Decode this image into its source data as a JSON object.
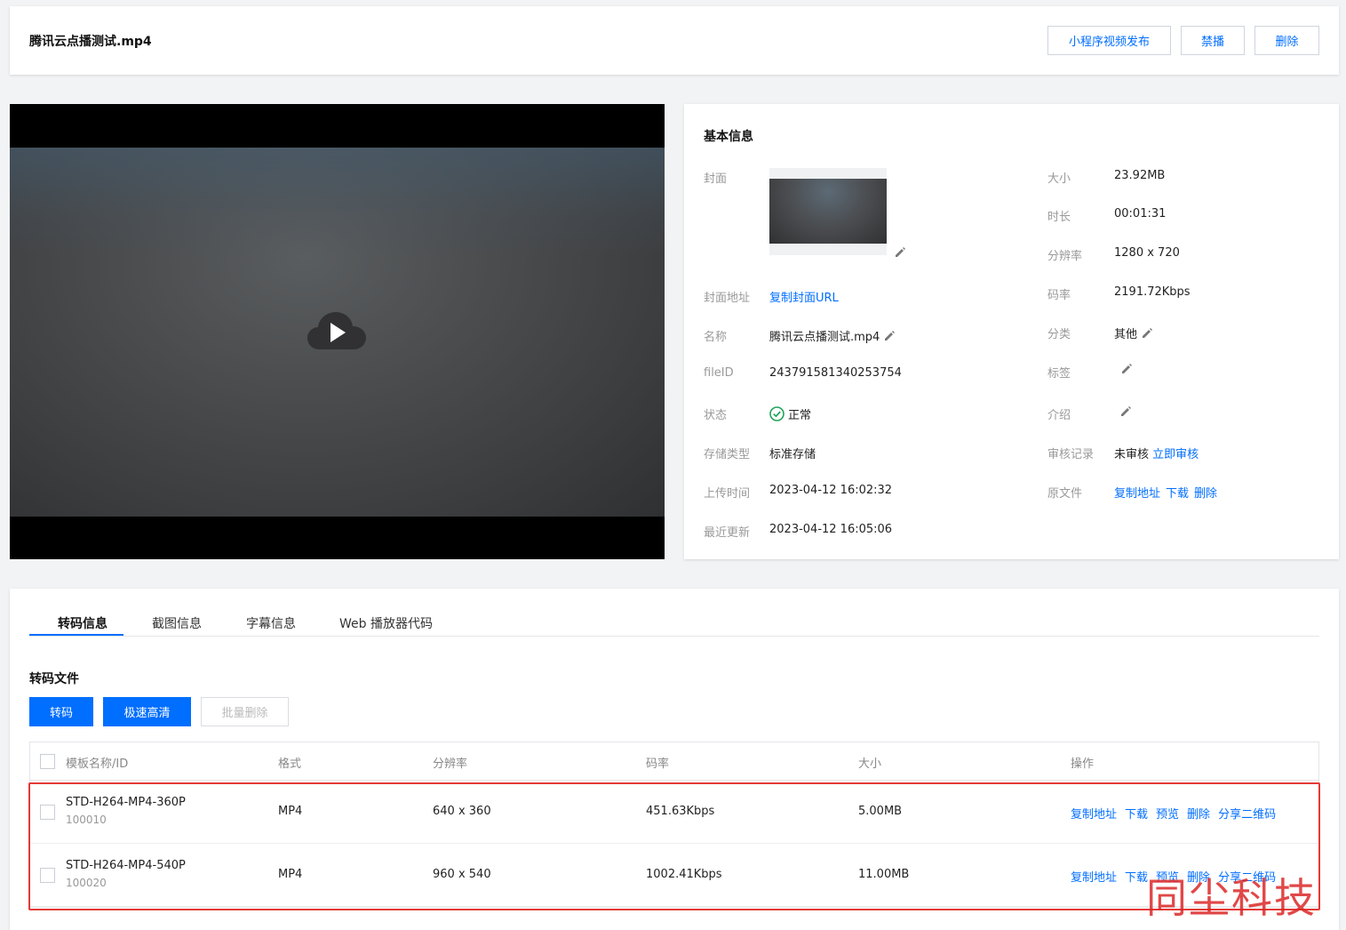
{
  "header": {
    "title": "腾讯云点播测试.mp4",
    "buttons": {
      "publish": "小程序视频发布",
      "ban": "禁播",
      "delete": "删除"
    }
  },
  "info": {
    "title": "基本信息",
    "left": {
      "cover_label": "封面",
      "cover_url_label": "封面地址",
      "cover_url_link": "复制封面URL",
      "name_label": "名称",
      "name_value": "腾讯云点播测试.mp4",
      "fileid_label": "fileID",
      "fileid_value": "243791581340253754",
      "status_label": "状态",
      "status_value": "正常",
      "storage_label": "存储类型",
      "storage_value": "标准存储",
      "upload_label": "上传时间",
      "upload_value": "2023-04-12 16:02:32",
      "update_label": "最近更新",
      "update_value": "2023-04-12 16:05:06"
    },
    "right": {
      "size_label": "大小",
      "size_value": "23.92MB",
      "duration_label": "时长",
      "duration_value": "00:01:31",
      "resolution_label": "分辨率",
      "resolution_value": "1280 x 720",
      "bitrate_label": "码率",
      "bitrate_value": "2191.72Kbps",
      "category_label": "分类",
      "category_value": "其他",
      "tags_label": "标签",
      "intro_label": "介绍",
      "review_label": "审核记录",
      "review_value": "未审核",
      "review_link": "立即审核",
      "source_label": "原文件",
      "source_links": [
        "复制地址",
        "下载",
        "删除"
      ]
    }
  },
  "tabs": [
    "转码信息",
    "截图信息",
    "字幕信息",
    "Web 播放器代码"
  ],
  "transcode": {
    "title": "转码文件",
    "buttons": {
      "transcode": "转码",
      "tesla": "极速高清",
      "batch_delete": "批量删除"
    },
    "columns": [
      "模板名称/ID",
      "格式",
      "分辨率",
      "码率",
      "大小",
      "操作"
    ],
    "rows": [
      {
        "name": "STD-H264-MP4-360P",
        "id": "100010",
        "format": "MP4",
        "resolution": "640 x 360",
        "bitrate": "451.63Kbps",
        "size": "5.00MB"
      },
      {
        "name": "STD-H264-MP4-540P",
        "id": "100020",
        "format": "MP4",
        "resolution": "960 x 540",
        "bitrate": "1002.41Kbps",
        "size": "11.00MB"
      }
    ],
    "ops": [
      "复制地址",
      "下载",
      "预览",
      "删除",
      "分享二维码"
    ]
  },
  "watermark": "同尘科技",
  "colors": {
    "accent": "#006eff",
    "highlight": "#e53935",
    "status_ok": "#21a35b"
  }
}
